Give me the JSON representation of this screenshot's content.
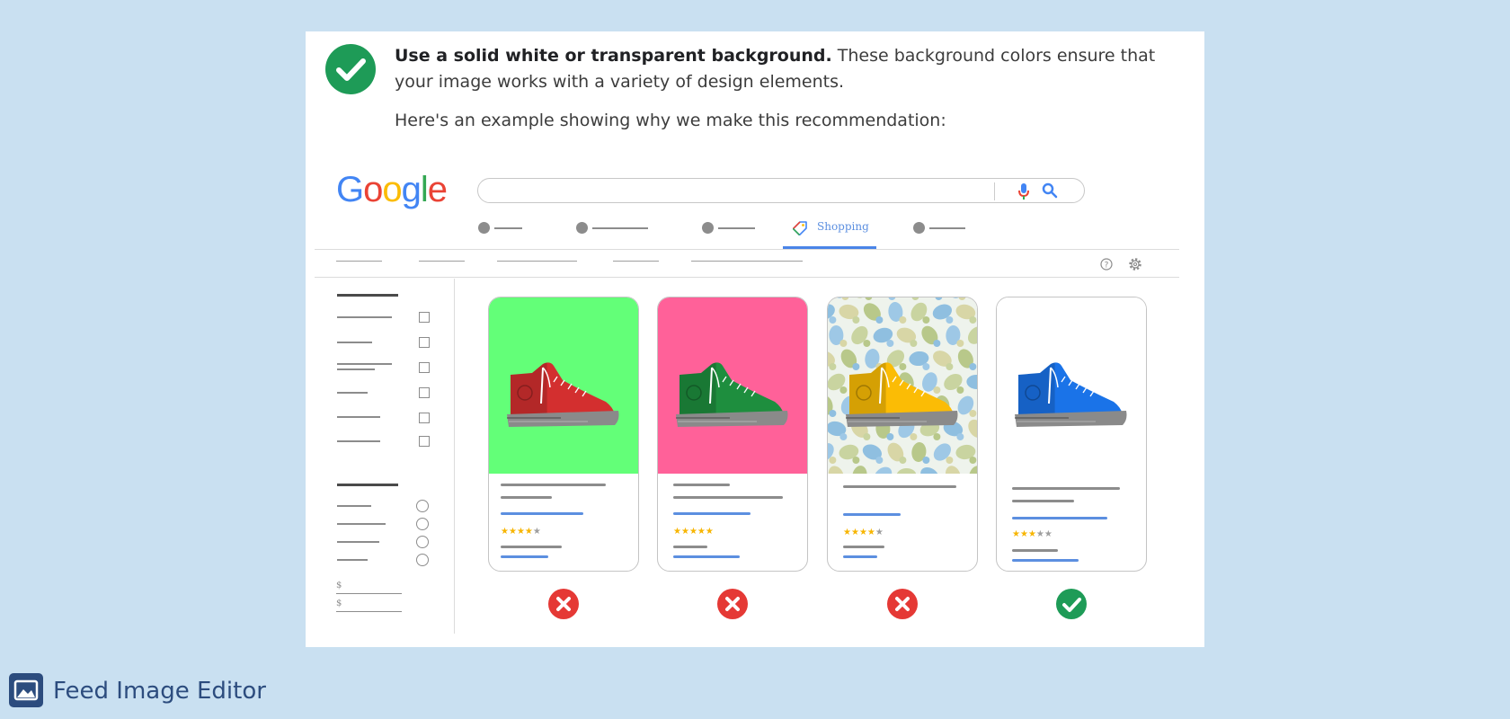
{
  "guideline": {
    "bold": "Use a solid white or transparent background.",
    "rest": " These background colors ensure that your image works with a variety of design elements.",
    "example": "Here's an example showing why we make this recommendation:"
  },
  "mockup": {
    "logo_letters": [
      {
        "ch": "G",
        "color": "#4285F4"
      },
      {
        "ch": "o",
        "color": "#EA4335"
      },
      {
        "ch": "o",
        "color": "#FBBC05"
      },
      {
        "ch": "g",
        "color": "#4285F4"
      },
      {
        "ch": "l",
        "color": "#34A853"
      },
      {
        "ch": "e",
        "color": "#EA4335"
      }
    ],
    "shopping_tab": "Shopping",
    "products": [
      {
        "background": "#63ff78",
        "shoe_color": "#d32f2f",
        "stars": 4,
        "verdict": "rejected"
      },
      {
        "background": "#ff6199",
        "shoe_color": "#1e8e3e",
        "stars": 5,
        "verdict": "rejected"
      },
      {
        "background": "pattern",
        "shoe_color": "#fbbc05",
        "stars": 4,
        "verdict": "rejected"
      },
      {
        "background": "#ffffff",
        "shoe_color": "#1a73e8",
        "stars": 3,
        "verdict": "approved"
      }
    ],
    "price_symbols": [
      "$",
      "$"
    ]
  },
  "brand": {
    "name": "Feed Image Editor"
  },
  "colors": {
    "approve": "#1e9b57",
    "reject": "#e53935",
    "page_bg": "#c9e0f1",
    "brand": "#2c4c7e"
  }
}
